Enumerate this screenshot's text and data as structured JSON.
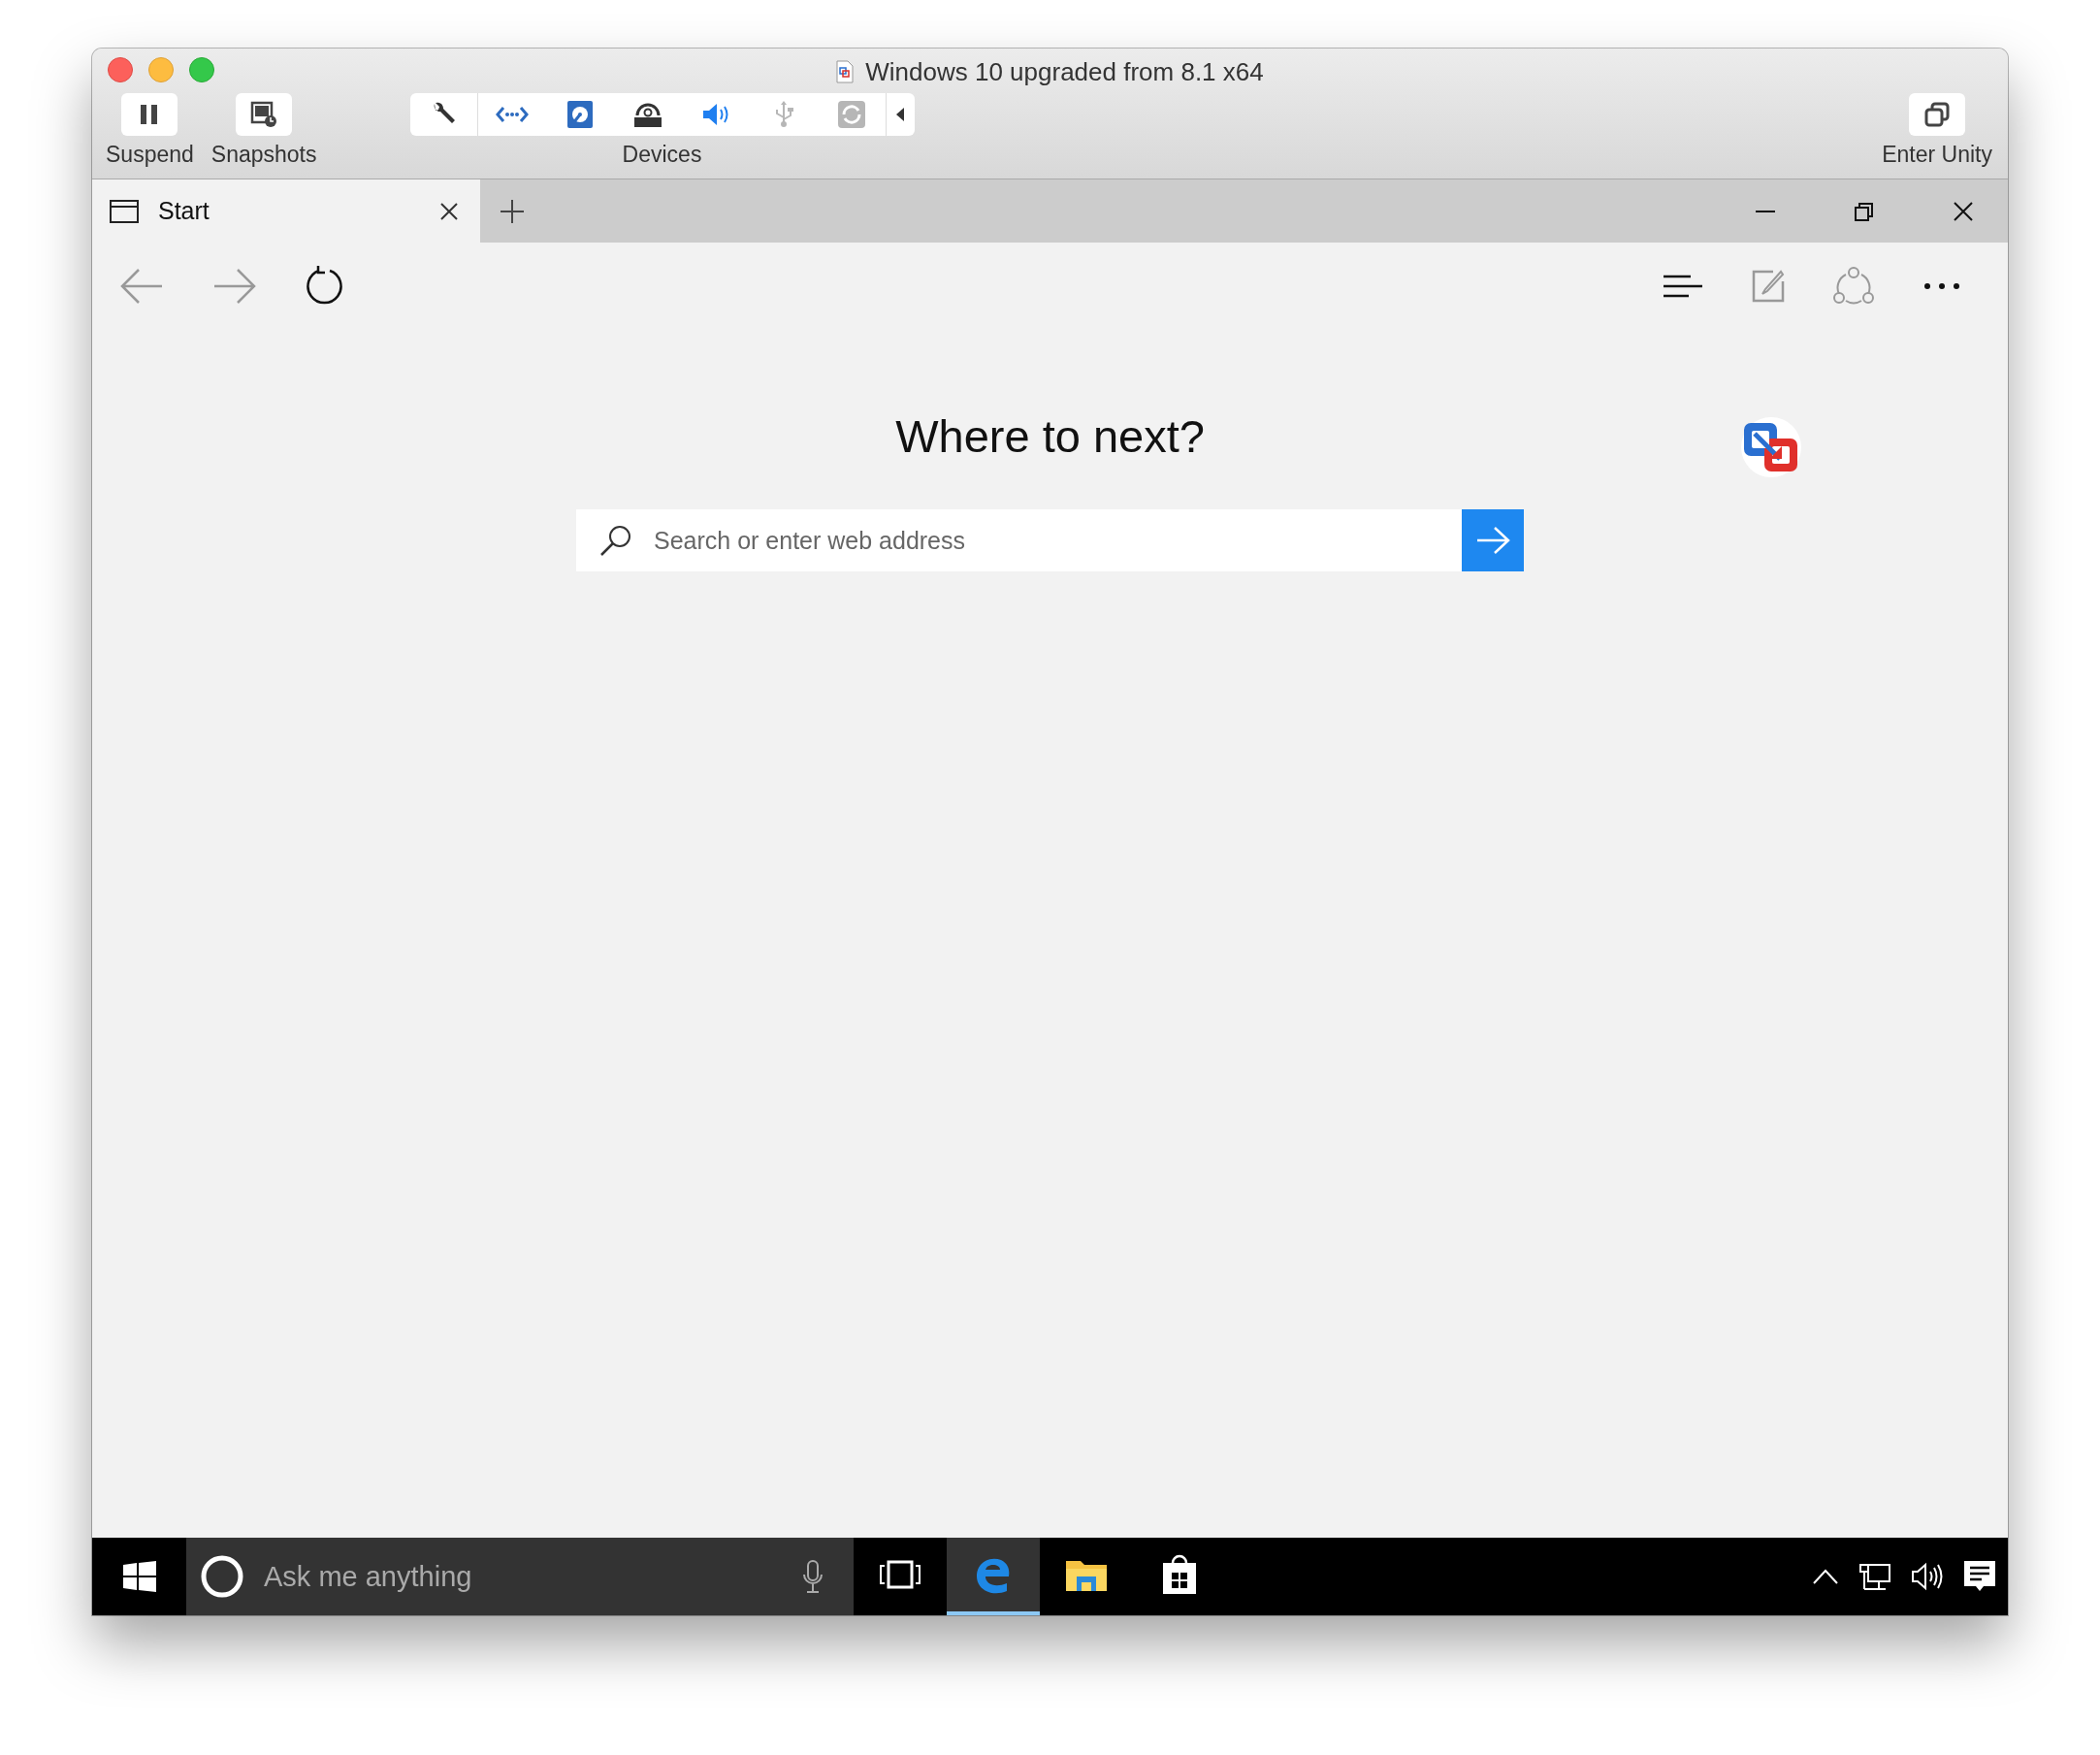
{
  "window": {
    "title": "Windows 10 upgraded from 8.1 x64"
  },
  "toolbar": {
    "suspend": "Suspend",
    "snapshots": "Snapshots",
    "devices_label": "Devices",
    "unity": "Enter Unity",
    "devices": [
      {
        "kind": "settings",
        "active": true
      },
      {
        "kind": "network",
        "active": true
      },
      {
        "kind": "disk",
        "active": true
      },
      {
        "kind": "optical",
        "active": true
      },
      {
        "kind": "sound",
        "active": true
      },
      {
        "kind": "usb",
        "active": false
      },
      {
        "kind": "sync",
        "active": false
      }
    ]
  },
  "browser": {
    "tabs": [
      {
        "label": "Start",
        "selected": true
      }
    ],
    "heading": "Where to next?",
    "search": {
      "placeholder": "Search or enter web address"
    }
  },
  "taskbar": {
    "cortana": {
      "placeholder": "Ask me anything"
    },
    "apps": [
      {
        "kind": "taskview",
        "selected": false
      },
      {
        "kind": "edge",
        "selected": true
      },
      {
        "kind": "explorer",
        "selected": false
      },
      {
        "kind": "store",
        "selected": false
      }
    ]
  }
}
